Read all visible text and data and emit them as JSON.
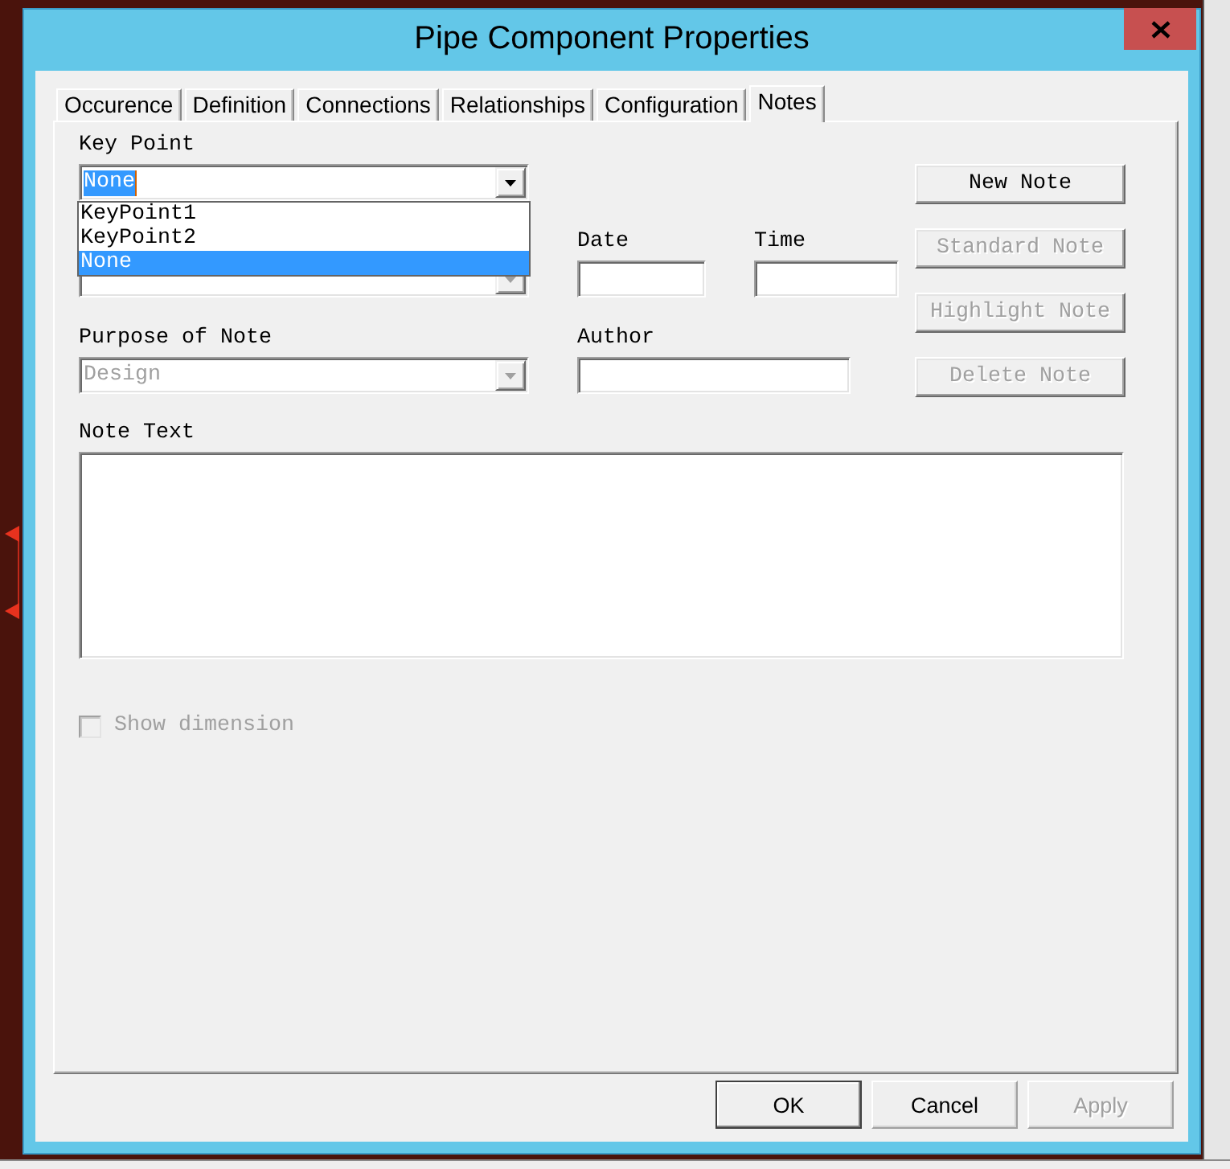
{
  "window": {
    "title": "Pipe Component Properties"
  },
  "tabs": [
    {
      "label": "Occurence",
      "selected": false
    },
    {
      "label": "Definition",
      "selected": false
    },
    {
      "label": "Connections",
      "selected": false
    },
    {
      "label": "Relationships",
      "selected": false
    },
    {
      "label": "Configuration",
      "selected": false
    },
    {
      "label": "Notes",
      "selected": true
    }
  ],
  "notes_tab": {
    "key_point": {
      "label": "Key Point",
      "value": "None",
      "focused": true,
      "expanded": true,
      "options": [
        {
          "label": "KeyPoint1",
          "selected": false
        },
        {
          "label": "KeyPoint2",
          "selected": false
        },
        {
          "label": "None",
          "selected": true
        }
      ]
    },
    "covered_dropdown": {
      "disabled": true
    },
    "date": {
      "label": "Date"
    },
    "time": {
      "label": "Time"
    },
    "purpose_of_note": {
      "label": "Purpose of Note",
      "value": "Design",
      "disabled": true
    },
    "author": {
      "label": "Author"
    },
    "buttons": [
      {
        "label": "New Note",
        "disabled": false
      },
      {
        "label": "Standard Note",
        "disabled": true
      },
      {
        "label": "Highlight Note",
        "disabled": true
      },
      {
        "label": "Delete Note",
        "disabled": true
      }
    ],
    "note_text": {
      "label": "Note Text"
    },
    "show_dimension": {
      "label": "Show dimension",
      "checked": false,
      "disabled": true
    }
  },
  "dialog_buttons": [
    {
      "label": "OK",
      "default": true,
      "disabled": false
    },
    {
      "label": "Cancel",
      "default": false,
      "disabled": false
    },
    {
      "label": "Apply",
      "default": false,
      "disabled": true
    }
  ]
}
